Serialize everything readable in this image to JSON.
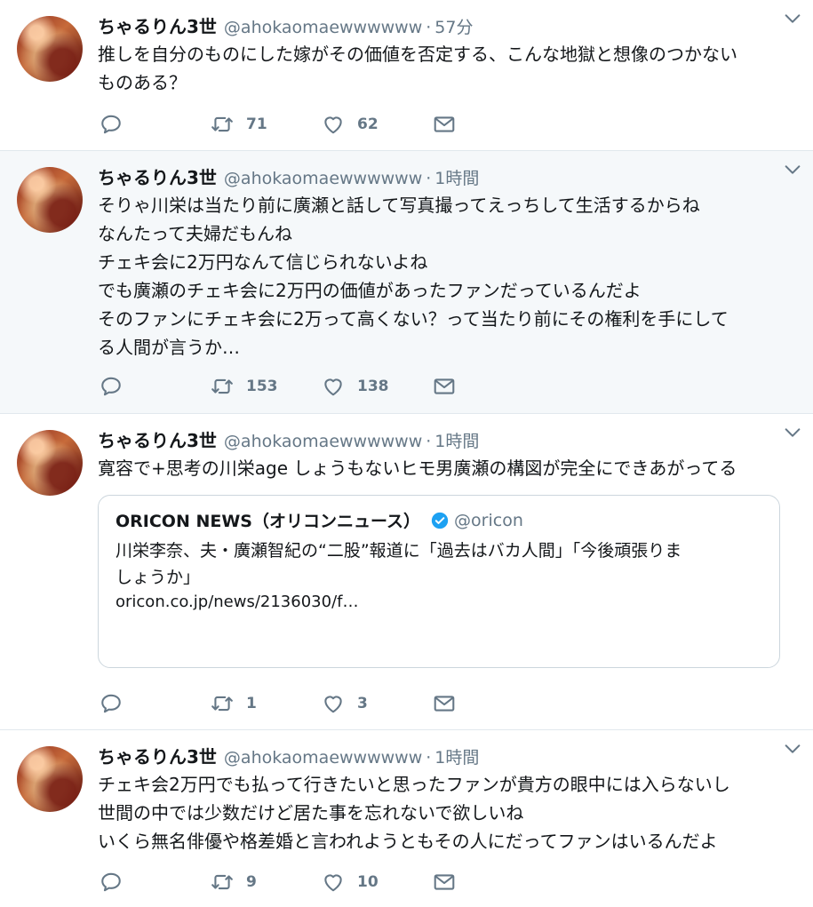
{
  "tweets": [
    {
      "name": "ちゃるりん3世",
      "handle": "@ahokaomaewwwwww",
      "sep": "·",
      "time": "57分",
      "text": "推しを自分のものにした嫁がその価値を否定する、こんな地獄と想像のつかない\nものある？",
      "retweets": "71",
      "likes": "62"
    },
    {
      "name": "ちゃるりん3世",
      "handle": "@ahokaomaewwwwww",
      "sep": "·",
      "time": "1時間",
      "text": "そりゃ川栄は当たり前に廣瀬と話して写真撮ってえっちして生活するからね\nなんたって夫婦だもんね\nチェキ会に2万円なんて信じられないよね\nでも廣瀬のチェキ会に2万円の価値があったファンだっているんだよ\nそのファンにチェキ会に2万って高くない？って当たり前にその権利を手にして\nる人間が言うか…",
      "retweets": "153",
      "likes": "138"
    },
    {
      "name": "ちゃるりん3世",
      "handle": "@ahokaomaewwwwww",
      "sep": "·",
      "time": "1時間",
      "text": "寛容で+思考の川栄age しょうもないヒモ男廣瀬の構図が完全にできあがってる",
      "quote": {
        "name": "ORICON NEWS（オリコンニュース）",
        "handle": "@oricon",
        "text": "川栄李奈、夫・廣瀬智紀の“二股”報道に「過去はバカ人間」「今後頑張りま\nしょうか」",
        "url": "oricon.co.jp/news/2136030/f…"
      },
      "retweets": "1",
      "likes": "3"
    },
    {
      "name": "ちゃるりん3世",
      "handle": "@ahokaomaewwwwww",
      "sep": "·",
      "time": "1時間",
      "text": "チェキ会2万円でも払って行きたいと思ったファンが貴方の眼中には入らないし\n世間の中では少数だけど居た事を忘れないで欲しいね\nいくら無名俳優や格差婚と言われようともその人にだってファンはいるんだよ",
      "retweets": "9",
      "likes": "10"
    }
  ],
  "colors": {
    "secondary_text": "#657786",
    "verified": "#1da1f2",
    "alt_bg": "#f5f8fa",
    "border": "#e1e8ed"
  }
}
